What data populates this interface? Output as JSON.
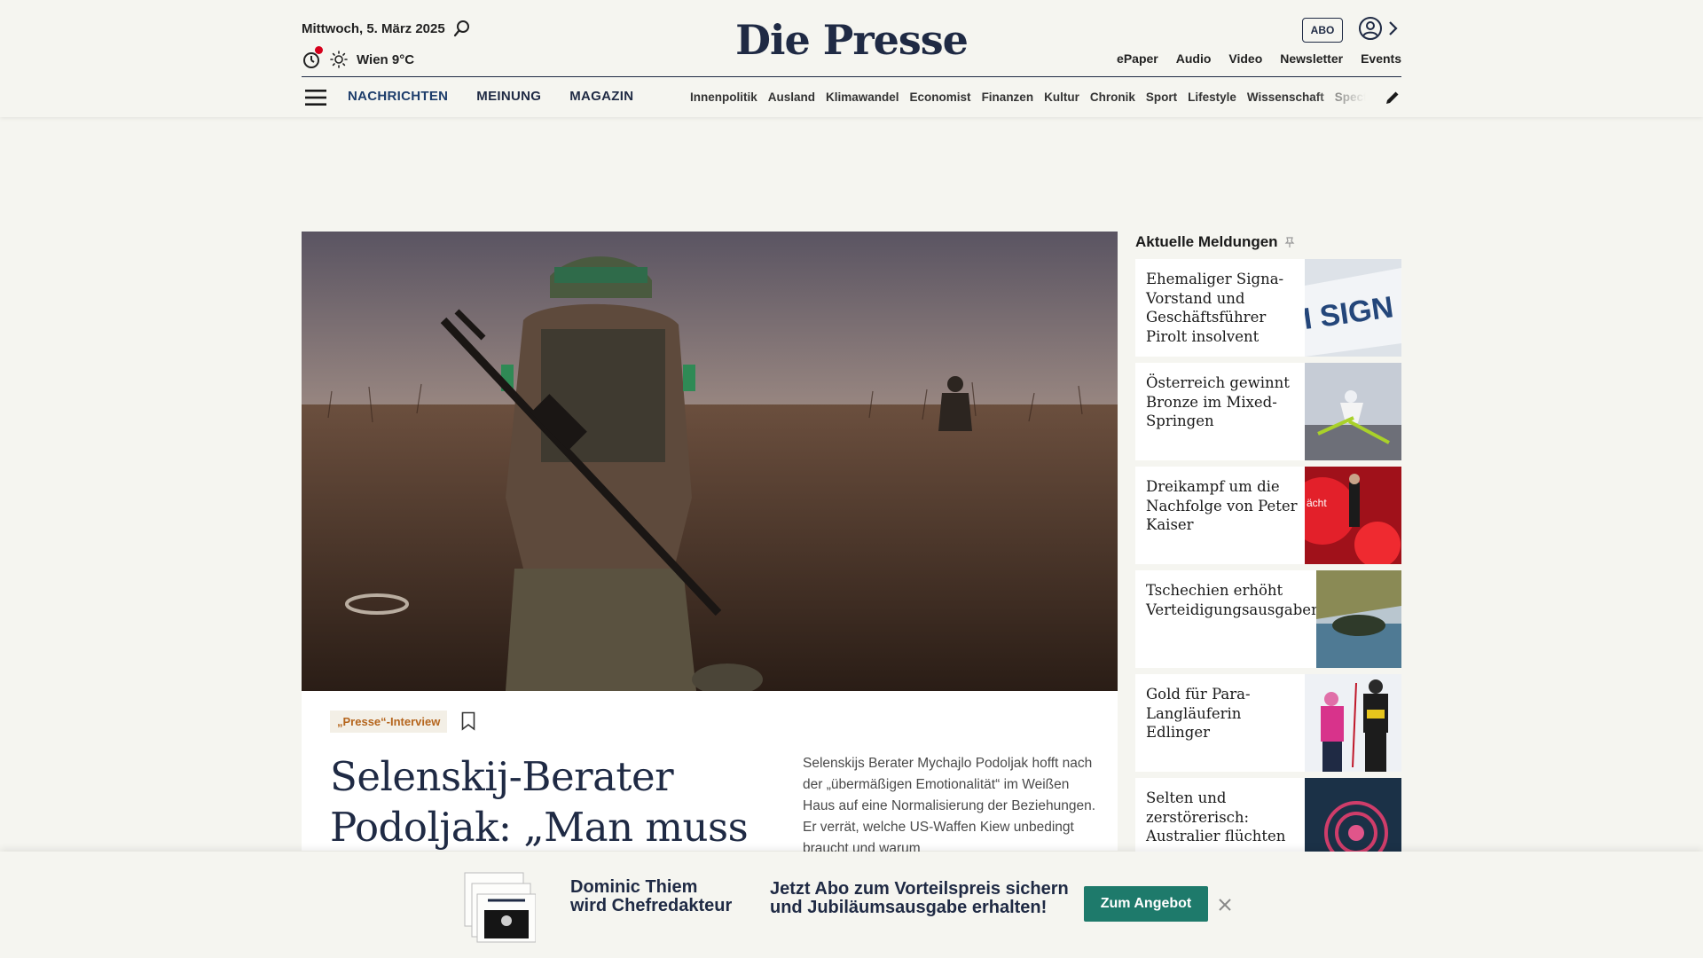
{
  "header": {
    "date": "Mittwoch, 5. März 2025",
    "weather": "Wien 9°C",
    "logo": "Die Presse",
    "abo": "ABO",
    "links": [
      "ePaper",
      "Audio",
      "Video",
      "Newsletter",
      "Events"
    ]
  },
  "nav": {
    "main": [
      "NACHRICHTEN",
      "MEINUNG",
      "MAGAZIN"
    ],
    "categories": [
      "Innenpolitik",
      "Ausland",
      "Klimawandel",
      "Economist",
      "Finanzen",
      "Kultur",
      "Chronik",
      "Sport",
      "Lifestyle",
      "Wissenschaft",
      "Spectrum"
    ]
  },
  "article": {
    "tag": "„Presse“-Interview",
    "headline": "Selenskij-Berater Podoljak: „Man muss",
    "lead": "Selenskijs Berater Mychajlo Podoljak hofft nach der „übermäßigen Emotionalität“ im Weißen Haus auf eine Normalisierung der Beziehungen. Er verrät, welche US-Waffen Kiew unbedingt braucht und warum"
  },
  "sidebar": {
    "title": "Aktuelle Meldungen",
    "items": [
      {
        "title": "Ehemaliger Signa-Vorstand und Geschäftsführer Pirolt insolvent"
      },
      {
        "title": "Österreich gewinnt Bronze im Mixed-Springen"
      },
      {
        "title": "Dreikampf um die Nachfolge von Peter Kaiser"
      },
      {
        "title": "Tschechien erhöht Verteidigungsausgaben"
      },
      {
        "title": "Gold für Para-Langläuferin Edlinger"
      },
      {
        "title": "Selten und zerstörerisch: Australier flüchten"
      }
    ]
  },
  "banner": {
    "line1": "Dominic Thiem",
    "line2": "wird Chefredakteur",
    "offer1": "Jetzt Abo zum Vorteilspreis sichern",
    "offer2": "und Jubiläumsausgabe erhalten!",
    "button": "Zum Angebot"
  },
  "colors": {
    "navy": "#1f2a44",
    "accent_red": "#d6001c",
    "cta_green": "#1e7a6b",
    "tag_orange": "#b5651d"
  }
}
